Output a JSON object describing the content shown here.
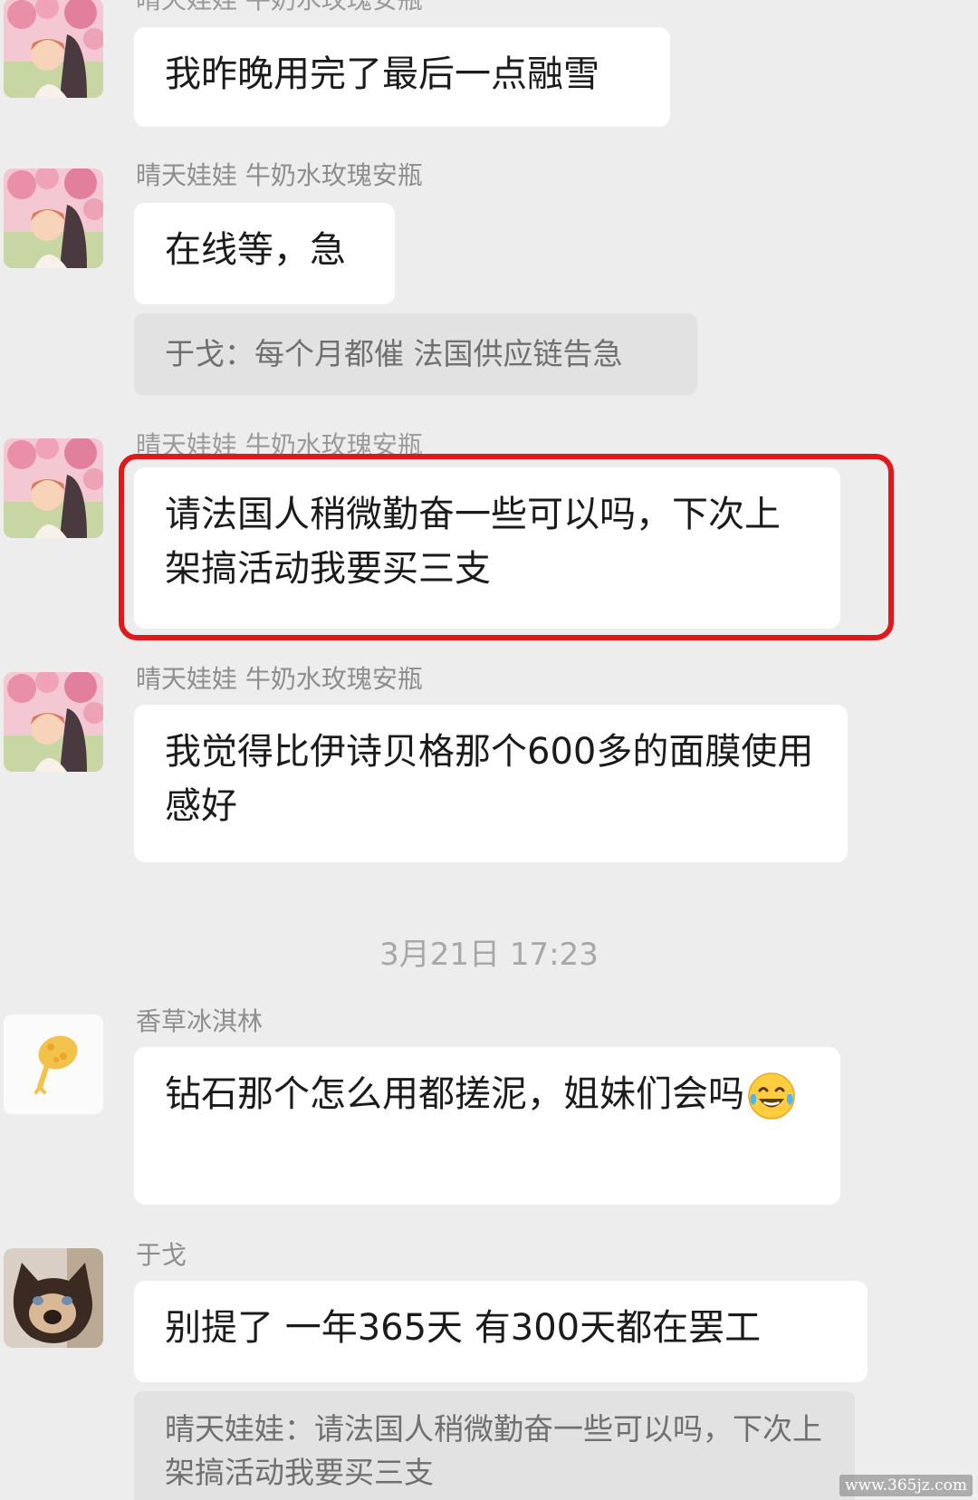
{
  "messages": [
    {
      "sender": "晴天娃娃 牛奶水玫瑰安瓶",
      "text": "我昨晚用完了最后一点融雪"
    },
    {
      "sender": "晴天娃娃 牛奶水玫瑰安瓶",
      "text": "在线等，急",
      "quote": "于戈：每个月都催 法国供应链告急"
    },
    {
      "sender": "晴天娃娃 牛奶水玫瑰安瓶",
      "text": "请法国人稍微勤奋一些可以吗，下次上架搞活动我要买三支"
    },
    {
      "sender": "晴天娃娃 牛奶水玫瑰安瓶",
      "text": "我觉得比伊诗贝格那个600多的面膜使用感好"
    },
    {
      "sender": "香草冰淇林",
      "text": "钻石那个怎么用都搓泥，姐妹们会吗",
      "emoji": "face-with-tears-of-joy"
    },
    {
      "sender": "于戈",
      "text": "别提了 一年365天 有300天都在罢工",
      "quote": "晴天娃娃：请法国人稍微勤奋一些可以吗，下次上架搞活动我要买三支"
    }
  ],
  "timestamp": "3月21日 17:23",
  "highlight_color": "#e0191a",
  "watermark": "www.365jz.com"
}
